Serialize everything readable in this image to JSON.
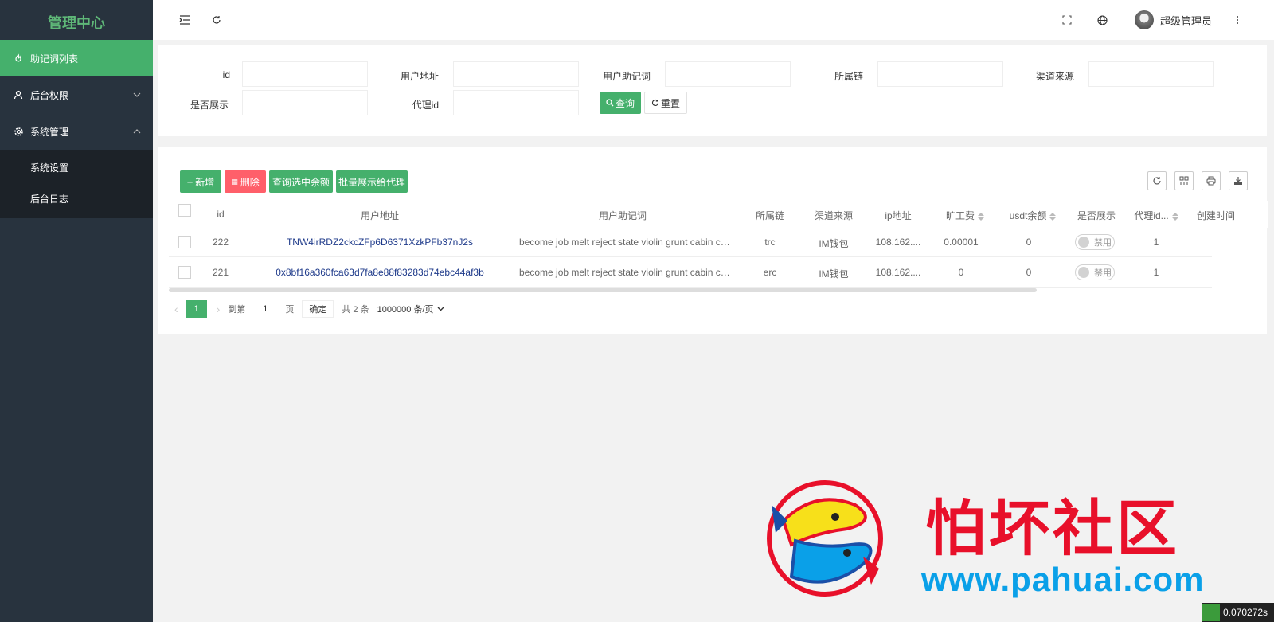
{
  "sidebar": {
    "logo": "管理中心",
    "items": [
      {
        "label": "助记词列表",
        "icon": "fire-icon"
      },
      {
        "label": "后台权限",
        "icon": "user-icon"
      },
      {
        "label": "系统管理",
        "icon": "gear-icon"
      }
    ],
    "subitems": [
      "系统设置",
      "后台日志"
    ]
  },
  "header": {
    "username": "超级管理员",
    "icons": [
      "menu-fold-icon",
      "refresh-icon",
      "fullscreen-icon",
      "globe-icon",
      "more-icon"
    ]
  },
  "search": {
    "labels": {
      "id": "id",
      "address": "用户地址",
      "mnemonic": "用户助记词",
      "chain": "所属链",
      "channel": "渠道来源",
      "display": "是否展示",
      "agent": "代理id"
    },
    "query_label": "查询",
    "reset_label": "重置"
  },
  "toolbar": {
    "add_label": "新增",
    "delete_label": "删除",
    "check_balance_label": "查询选中余额",
    "batch_show_label": "批量展示给代理"
  },
  "table": {
    "columns": [
      "id",
      "用户地址",
      "用户助记词",
      "所属链",
      "渠道来源",
      "ip地址",
      "旷工费",
      "usdt余额",
      "是否展示",
      "代理id...",
      "创建时间"
    ],
    "rows": [
      {
        "id": "222",
        "address": "TNW4irRDZ2ckcZFp6D6371XzkPFb37nJ2s",
        "mnemonic": "become job melt reject state violin grunt cabin cattle r...",
        "chain": "trc",
        "channel": "IM钱包",
        "ip": "108.162....",
        "fee": "0.00001",
        "usdt": "0",
        "display": "禁用",
        "agent": "1"
      },
      {
        "id": "221",
        "address": "0x8bf16a360fca63d7fa8e88f83283d74ebc44af3b",
        "mnemonic": "become job melt reject state violin grunt cabin cattle r...",
        "chain": "erc",
        "channel": "IM钱包",
        "ip": "108.162....",
        "fee": "0",
        "usdt": "0",
        "display": "禁用",
        "agent": "1"
      }
    ]
  },
  "pager": {
    "current": "1",
    "goto_label": "到第",
    "goto_value": "1",
    "page_label": "页",
    "confirm_label": "确定",
    "total": "共 2 条",
    "per_page": "1000000 条/页"
  },
  "watermark": {
    "title": "怕坏社区",
    "url": "www.pahuai.com"
  },
  "timer": "0.070272s",
  "colors": {
    "accent": "#45b06c",
    "sidebar": "#28333e",
    "danger": "#ff5f6a"
  }
}
